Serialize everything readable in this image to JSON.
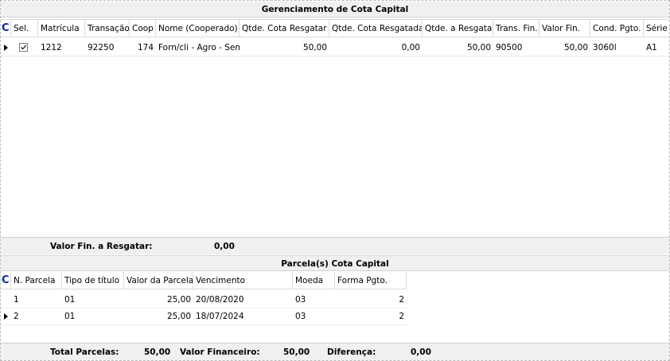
{
  "capital": {
    "title": "Gerenciamento de Cota Capital",
    "corner_glyph": "C",
    "columns": [
      "Sel.",
      "Matrícula",
      "Transação",
      "Coop",
      "Nome (Cooperado)",
      "Qtde. Cota Resgatar",
      "Qtde. Cota Resgatada",
      "Qtde. a Resgatar",
      "Trans. Fin.",
      "Valor Fin.",
      "Cond. Pgto.",
      "Série"
    ],
    "rows": [
      {
        "selected": true,
        "matricula": "1212",
        "transacao": "92250",
        "coop": "174",
        "nome": "Forn/cli - Agro - Sem",
        "qtde_cota_resgatar": "50,00",
        "qtde_cota_resgatada": "0,00",
        "qtde_a_resgatar": "50,00",
        "trans_fin": "90500",
        "valor_fin": "50,00",
        "cond_pgto": "3060l",
        "serie": "A1"
      }
    ],
    "footer_label": "Valor Fin. a Resgatar:",
    "footer_value": "0,00"
  },
  "parcelas": {
    "title": "Parcela(s) Cota Capital",
    "corner_glyph": "C",
    "columns": [
      "N. Parcela",
      "Tipo de título",
      "Valor da Parcela",
      "Vencimento",
      "Moeda",
      "Forma Pgto."
    ],
    "rows": [
      {
        "n": "1",
        "tipo": "01",
        "valor": "25,00",
        "vencimento": "20/08/2020",
        "moeda": "03",
        "forma": "2"
      },
      {
        "n": "2",
        "tipo": "01",
        "valor": "25,00",
        "vencimento": "18/07/2024",
        "moeda": "03",
        "forma": "2"
      }
    ]
  },
  "totals": {
    "total_parcelas_label": "Total Parcelas:",
    "total_parcelas_value": "50,00",
    "valor_financeiro_label": "Valor Financeiro:",
    "valor_financeiro_value": "50,00",
    "diferenca_label": "Diferença:",
    "diferenca_value": "0,00"
  },
  "colors": {
    "corner": "#0b2a9e",
    "panel": "#f0f0f0",
    "grid_line": "#dadada"
  }
}
